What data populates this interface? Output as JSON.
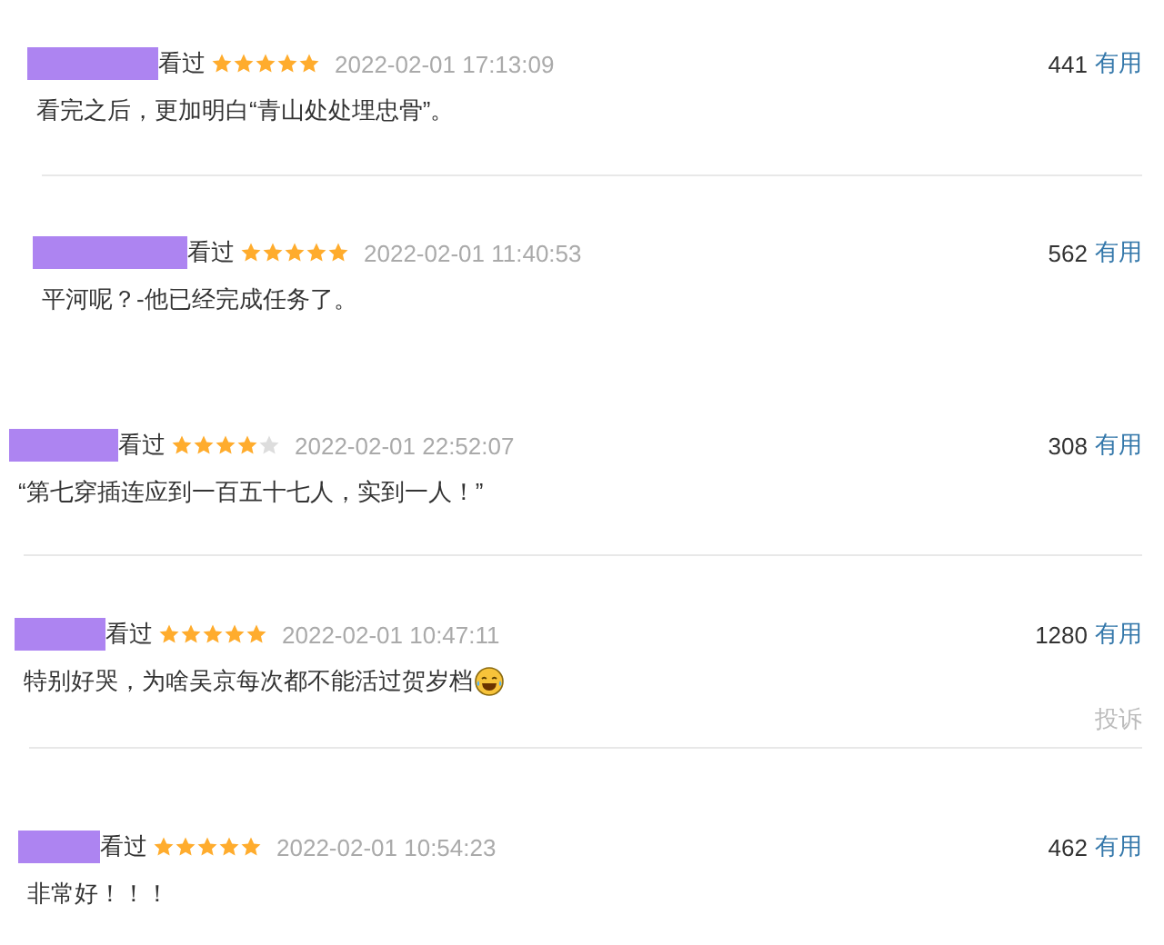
{
  "comments": [
    {
      "status": "看过",
      "stars": 5,
      "time": "2022-02-01 17:13:09",
      "votes": "441",
      "useful": "有用",
      "text": "看完之后，更加明白“青山处处埋忠骨”。",
      "kind": "plain"
    },
    {
      "status": "看过",
      "stars": 5,
      "time": "2022-02-01 11:40:53",
      "votes": "562",
      "useful": "有用",
      "text": "平河呢？-他已经完成任务了。",
      "kind": "plain"
    },
    {
      "status": "看过",
      "stars": 4,
      "time": "2022-02-01 22:52:07",
      "votes": "308",
      "useful": "有用",
      "text": "“第七穿插连应到一百五十七人，实到一人！”",
      "kind": "plain"
    },
    {
      "status": "看过",
      "stars": 5,
      "time": "2022-02-01 10:47:11",
      "votes": "1280",
      "useful": "有用",
      "text": "特别好哭，为啥吴京每次都不能活过贺岁档",
      "kind": "emoji",
      "report": "投诉"
    },
    {
      "status": "看过",
      "stars": 5,
      "time": "2022-02-01 10:54:23",
      "votes": "462",
      "useful": "有用",
      "text": "非常好！！！",
      "kind": "plain"
    }
  ]
}
